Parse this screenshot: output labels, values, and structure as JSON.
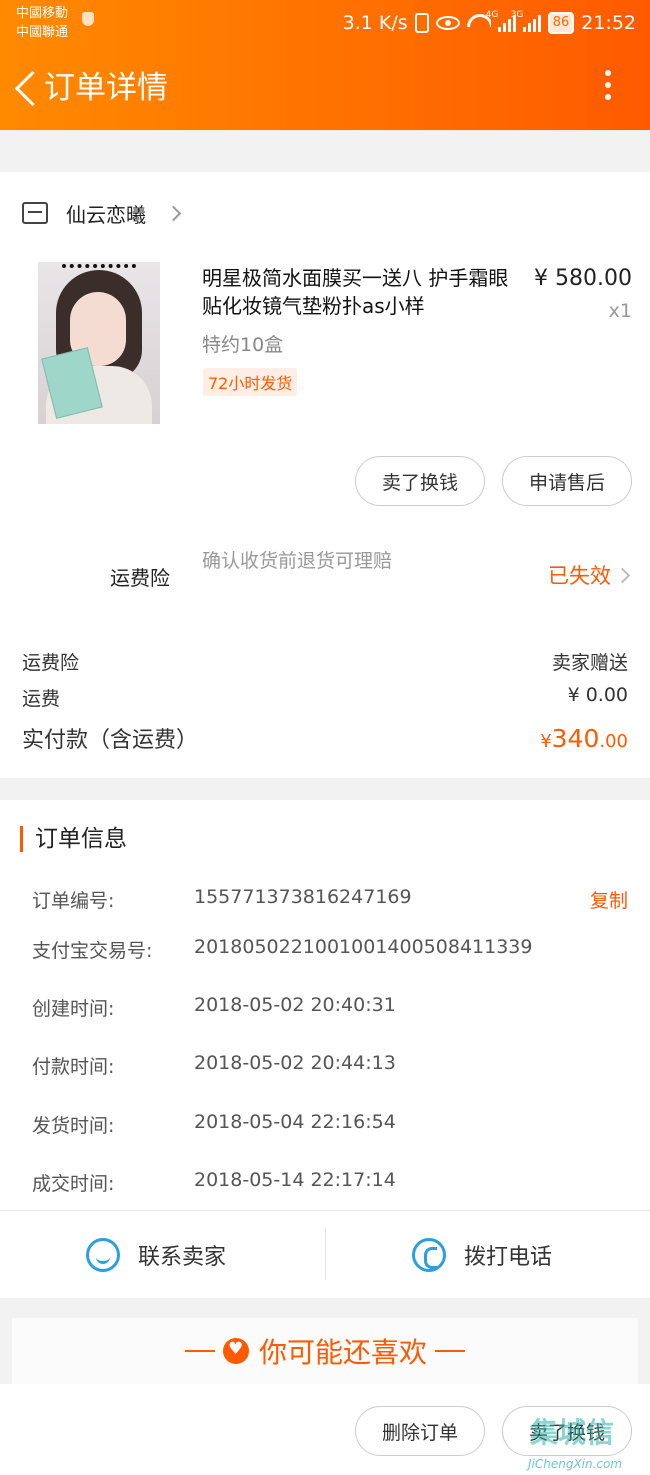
{
  "status_bar": {
    "carrier1": "中國移動",
    "carrier2": "中國聯通",
    "speed": "3.1 K/s",
    "net1": "4G",
    "net2": "3G",
    "battery": "86",
    "time": "21:52"
  },
  "header": {
    "title": "订单详情"
  },
  "shop": {
    "name": "仙云恋曦"
  },
  "product": {
    "name": "明星极简水面膜买一送八 护手霜眼贴化妆镜气垫粉扑as小样",
    "price": "¥ 580.00",
    "quantity": "x1",
    "sku": "特约10盒",
    "tag": "72小时发货"
  },
  "item_buttons": {
    "sell": "卖了换钱",
    "after_sale": "申请售后"
  },
  "insurance": {
    "label": "运费险",
    "desc": "确认收货前退货可理赔",
    "status": "已失效"
  },
  "summary": {
    "insurance_label": "运费险",
    "insurance_value": "卖家赠送",
    "shipping_label": "运费",
    "shipping_value": "¥ 0.00",
    "total_label": "实付款（含运费）",
    "total_symbol": "¥",
    "total_int": "340",
    "total_dec": ".00"
  },
  "order_info": {
    "title": "订单信息",
    "copy_label": "复制",
    "rows": [
      {
        "label": "订单编号:",
        "value": "155771373816247169"
      },
      {
        "label": "支付宝交易号:",
        "value": "2018050221001001400508411339"
      },
      {
        "label": "创建时间:",
        "value": "2018-05-02 20:40:31"
      },
      {
        "label": "付款时间:",
        "value": "2018-05-02 20:44:13"
      },
      {
        "label": "发货时间:",
        "value": "2018-05-04 22:16:54"
      },
      {
        "label": "成交时间:",
        "value": "2018-05-14 22:17:14"
      }
    ]
  },
  "actions": {
    "contact": "联系卖家",
    "call": "拨打电话"
  },
  "recommend": {
    "title": "你可能还喜欢"
  },
  "footer": {
    "delete": "删除订单",
    "sell": "卖了换钱"
  },
  "watermark": {
    "logo": "集城信",
    "url": "JiChengXin.com"
  },
  "colors": {
    "accent": "#ff5a00",
    "header_start": "#ff8a00",
    "icon_blue": "#2aa0e0"
  }
}
